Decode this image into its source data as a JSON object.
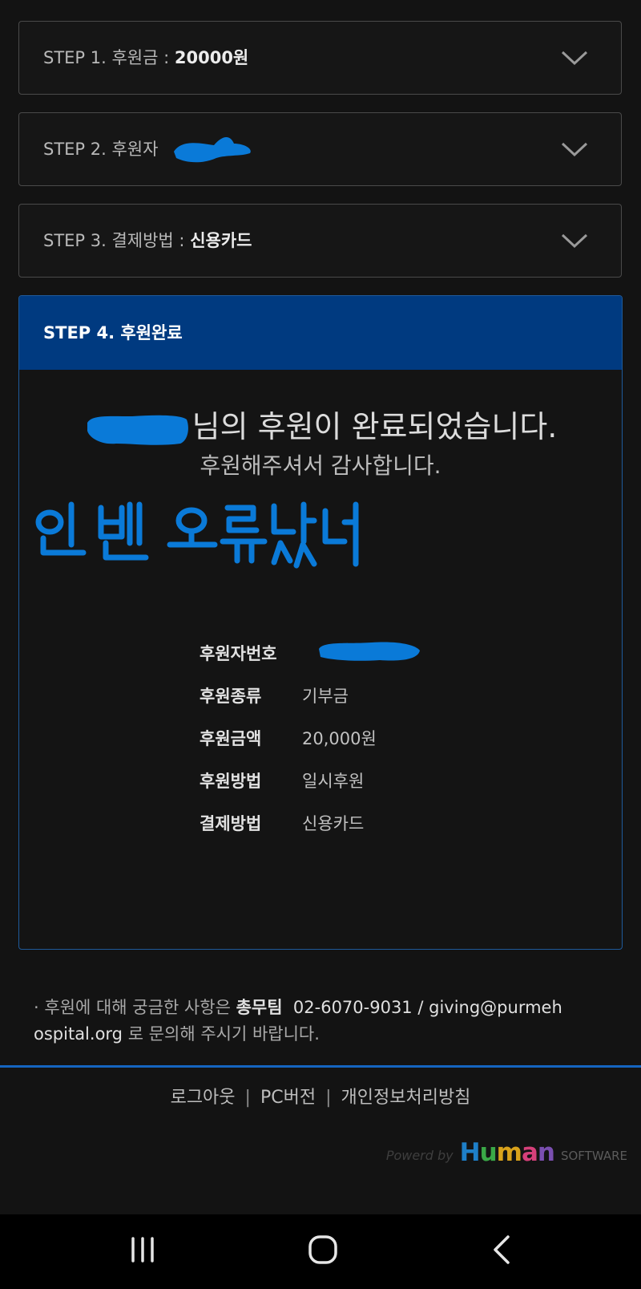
{
  "steps": [
    {
      "label": "STEP 1. 후원금 : ",
      "value": "20000원"
    },
    {
      "label": "STEP 2. 후원자 ",
      "value": ""
    },
    {
      "label": "STEP 3. 결제방법 : ",
      "value": "신용카드"
    }
  ],
  "step4": {
    "title": "STEP 4. 후원완료"
  },
  "completion": {
    "message": "님의 후원이 완료되었습니다.",
    "thanks": "후원해주셔서 감사합니다."
  },
  "annotation": {
    "handwritten": "인벤 오류났네"
  },
  "details": [
    {
      "key": "후원자번호",
      "value": ""
    },
    {
      "key": "후원종류",
      "value": "기부금"
    },
    {
      "key": "후원금액",
      "value": "20,000원"
    },
    {
      "key": "후원방법",
      "value": "일시후원"
    },
    {
      "key": "결제방법",
      "value": "신용카드"
    }
  ],
  "contact": {
    "prefix": "· 후원에 대해 궁금한 사항은 ",
    "team": "총무팀",
    "phone": "02-6070-9031",
    "slash": " / ",
    "email_part1": "giving@purmeh",
    "email_part2": "ospital.org",
    "suffix": " 로 문의해 주시기 바랍니다."
  },
  "footer": {
    "logout": "로그아웃",
    "pc": "PC버전",
    "privacy": "개인정보처리방침",
    "separator": "|"
  },
  "powered": {
    "by": "Powerd by",
    "brand": "Human",
    "brand_sub": "SOFTWARE"
  },
  "colors": {
    "accent": "#003a80",
    "redaction": "#0a7ad8",
    "link_bar": "#1565c0"
  },
  "icons": {
    "step_toggle": "chevron-down-icon",
    "nav": [
      "recent-apps-icon",
      "home-icon",
      "back-icon"
    ]
  }
}
